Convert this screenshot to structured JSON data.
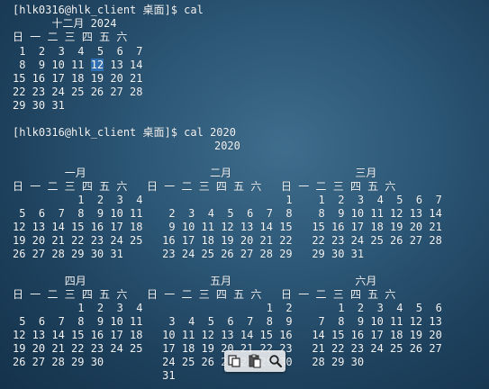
{
  "terminal": {
    "lines": [
      "[hlk0316@hlk_client 桌面]$ cal",
      "      十二月 2024",
      "日 一 二 三 四 五 六",
      " 1  2  3  4  5  6  7",
      " 8  9 10 11 12 13 14",
      "15 16 17 18 19 20 21",
      "22 23 24 25 26 27 28",
      "29 30 31",
      "",
      "[hlk0316@hlk_client 桌面]$ cal 2020",
      "                               2020",
      "",
      "        一月                   二月                   三月",
      "日 一 二 三 四 五 六   日 一 二 三 四 五 六   日 一 二 三 四 五 六",
      "          1  2  3  4                      1    1  2  3  4  5  6  7",
      " 5  6  7  8  9 10 11    2  3  4  5  6  7  8    8  9 10 11 12 13 14",
      "12 13 14 15 16 17 18    9 10 11 12 13 14 15   15 16 17 18 19 20 21",
      "19 20 21 22 23 24 25   16 17 18 19 20 21 22   22 23 24 25 26 27 28",
      "26 27 28 29 30 31      23 24 25 26 27 28 29   29 30 31",
      "",
      "        四月                   五月                   六月",
      "日 一 二 三 四 五 六   日 一 二 三 四 五 六   日 一 二 三 四 五 六",
      "          1  2  3  4                   1  2       1  2  3  4  5  6",
      " 5  6  7  8  9 10 11    3  4  5  6  7  8  9    7  8  9 10 11 12 13",
      "12 13 14 15 16 17 18   10 11 12 13 14 15 16   14 15 16 17 18 19 20",
      "19 20 21 22 23 24 25   17 18 19 20 21 22 23   21 22 23 24 25 26 27",
      "26 27 28 29 30         24 25 26 27 28 29 30   28 29 30",
      "                       31"
    ],
    "highlight": {
      "line": 4,
      "text": "12"
    }
  },
  "toolbar": {
    "buttons": [
      {
        "name": "copy-icon"
      },
      {
        "name": "paste-icon"
      },
      {
        "name": "search-icon"
      }
    ]
  },
  "colors": {
    "text": "#f2f4f6",
    "highlight": "#2f6fb3",
    "background": "#2d5877"
  }
}
